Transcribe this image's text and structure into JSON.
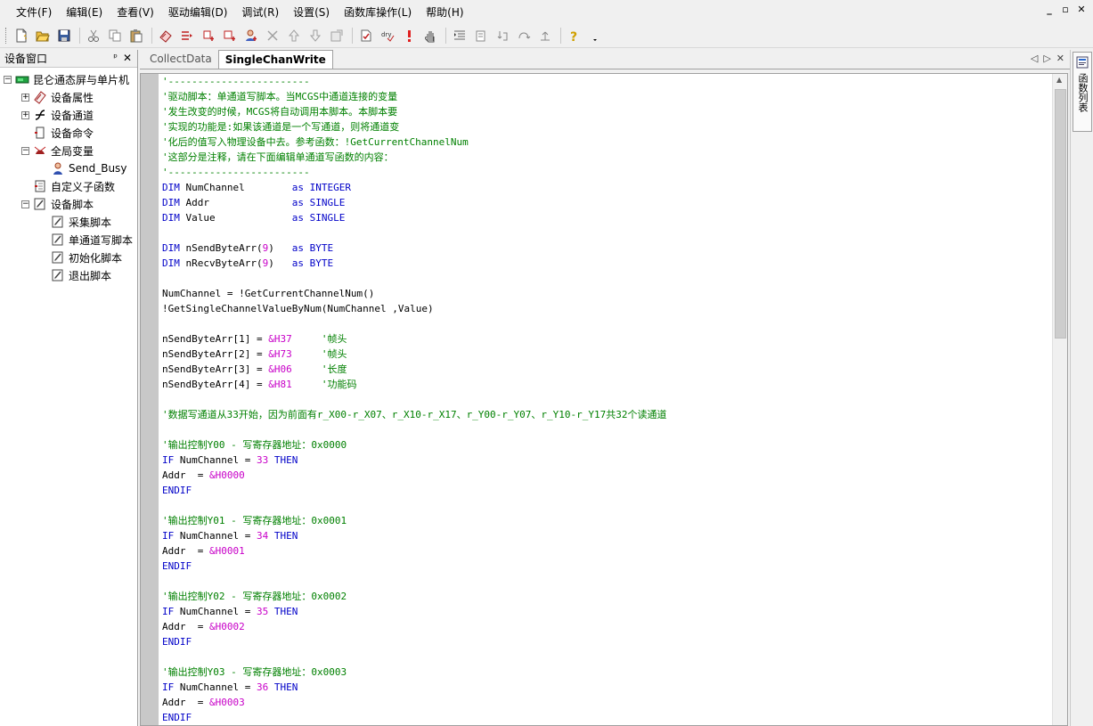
{
  "menu": [
    "文件(F)",
    "编辑(E)",
    "查看(V)",
    "驱动编辑(D)",
    "调试(R)",
    "设置(S)",
    "函数库操作(L)",
    "帮助(H)"
  ],
  "window_controls": [
    "_",
    "▫",
    "✕"
  ],
  "panel": {
    "title": "设备窗口",
    "pin": "ᵖ",
    "close": "✕",
    "tree": [
      {
        "label": "昆仑通态屏与单片机",
        "icon": "device-icon",
        "level": 0,
        "expander": "−"
      },
      {
        "label": "设备属性",
        "icon": "property-icon",
        "level": 1,
        "expander": "+"
      },
      {
        "label": "设备通道",
        "icon": "channel-icon",
        "level": 1,
        "expander": "+"
      },
      {
        "label": "设备命令",
        "icon": "command-icon",
        "level": 1,
        "expander": ""
      },
      {
        "label": "全局变量",
        "icon": "variables-icon",
        "level": 1,
        "expander": "−"
      },
      {
        "label": "Send_Busy",
        "icon": "user-icon",
        "level": 2,
        "expander": ""
      },
      {
        "label": "自定义子函数",
        "icon": "function-icon",
        "level": 1,
        "expander": ""
      },
      {
        "label": "设备脚本",
        "icon": "script-icon",
        "level": 1,
        "expander": "−"
      },
      {
        "label": "采集脚本",
        "icon": "script-icon",
        "level": 2,
        "expander": ""
      },
      {
        "label": "单通道写脚本",
        "icon": "script-icon",
        "level": 2,
        "expander": ""
      },
      {
        "label": "初始化脚本",
        "icon": "script-icon",
        "level": 2,
        "expander": ""
      },
      {
        "label": "退出脚本",
        "icon": "script-icon",
        "level": 2,
        "expander": ""
      }
    ]
  },
  "tabs": [
    {
      "label": "CollectData",
      "active": false
    },
    {
      "label": "SingleChanWrite",
      "active": true
    }
  ],
  "tab_controls": [
    "◁",
    "▷",
    "✕"
  ],
  "right_tab": {
    "label": "函数列表"
  },
  "code_lines": [
    [
      {
        "t": "'------------------------",
        "c": "com"
      }
    ],
    [
      {
        "t": "'驱动脚本：单通道写脚本。当MCGS中通道连接的变量",
        "c": "com"
      }
    ],
    [
      {
        "t": "'发生改变的时候，MCGS将自动调用本脚本。本脚本要",
        "c": "com"
      }
    ],
    [
      {
        "t": "'实现的功能是:如果该通道是一个写通道，则将通道变",
        "c": "com"
      }
    ],
    [
      {
        "t": "'化后的值写入物理设备中去。参考函数：!GetCurrentChannelNum",
        "c": "com"
      }
    ],
    [
      {
        "t": "'这部分是注释，请在下面编辑单通道写函数的内容：",
        "c": "com"
      }
    ],
    [
      {
        "t": "'------------------------",
        "c": "com"
      }
    ],
    [
      {
        "t": "DIM",
        "c": "kw"
      },
      {
        "t": " NumChannel        ",
        "c": "txt"
      },
      {
        "t": "as",
        "c": "kw"
      },
      {
        "t": " ",
        "c": "txt"
      },
      {
        "t": "INTEGER",
        "c": "kw"
      }
    ],
    [
      {
        "t": "DIM",
        "c": "kw"
      },
      {
        "t": " Addr              ",
        "c": "txt"
      },
      {
        "t": "as",
        "c": "kw"
      },
      {
        "t": " ",
        "c": "txt"
      },
      {
        "t": "SINGLE",
        "c": "kw"
      }
    ],
    [
      {
        "t": "DIM",
        "c": "kw"
      },
      {
        "t": " Value             ",
        "c": "txt"
      },
      {
        "t": "as",
        "c": "kw"
      },
      {
        "t": " ",
        "c": "txt"
      },
      {
        "t": "SINGLE",
        "c": "kw"
      }
    ],
    [],
    [
      {
        "t": "DIM",
        "c": "kw"
      },
      {
        "t": " nSendByteArr(",
        "c": "txt"
      },
      {
        "t": "9",
        "c": "num"
      },
      {
        "t": ")   ",
        "c": "txt"
      },
      {
        "t": "as",
        "c": "kw"
      },
      {
        "t": " ",
        "c": "txt"
      },
      {
        "t": "BYTE",
        "c": "kw"
      }
    ],
    [
      {
        "t": "DIM",
        "c": "kw"
      },
      {
        "t": " nRecvByteArr(",
        "c": "txt"
      },
      {
        "t": "9",
        "c": "num"
      },
      {
        "t": ")   ",
        "c": "txt"
      },
      {
        "t": "as",
        "c": "kw"
      },
      {
        "t": " ",
        "c": "txt"
      },
      {
        "t": "BYTE",
        "c": "kw"
      }
    ],
    [],
    [
      {
        "t": "NumChannel = !GetCurrentChannelNum()",
        "c": "txt"
      }
    ],
    [
      {
        "t": "!GetSingleChannelValueByNum(NumChannel ,Value)",
        "c": "txt"
      }
    ],
    [],
    [
      {
        "t": "nSendByteArr[1] = ",
        "c": "txt"
      },
      {
        "t": "&H37",
        "c": "hex"
      },
      {
        "t": "     ",
        "c": "txt"
      },
      {
        "t": "'帧头",
        "c": "com"
      }
    ],
    [
      {
        "t": "nSendByteArr[2] = ",
        "c": "txt"
      },
      {
        "t": "&H73",
        "c": "hex"
      },
      {
        "t": "     ",
        "c": "txt"
      },
      {
        "t": "'帧头",
        "c": "com"
      }
    ],
    [
      {
        "t": "nSendByteArr[3] = ",
        "c": "txt"
      },
      {
        "t": "&H06",
        "c": "hex"
      },
      {
        "t": "     ",
        "c": "txt"
      },
      {
        "t": "'长度",
        "c": "com"
      }
    ],
    [
      {
        "t": "nSendByteArr[4] = ",
        "c": "txt"
      },
      {
        "t": "&H81",
        "c": "hex"
      },
      {
        "t": "     ",
        "c": "txt"
      },
      {
        "t": "'功能码",
        "c": "com"
      }
    ],
    [],
    [
      {
        "t": "'数据写通道从33开始，因为前面有r_X00-r_X07、r_X10-r_X17、r_Y00-r_Y07、r_Y10-r_Y17共32个读通道",
        "c": "com"
      }
    ],
    [],
    [
      {
        "t": "'输出控制Y00 - 写寄存器地址：0x0000",
        "c": "com"
      }
    ],
    [
      {
        "t": "IF",
        "c": "kw"
      },
      {
        "t": " NumChannel = ",
        "c": "txt"
      },
      {
        "t": "33",
        "c": "num"
      },
      {
        "t": " ",
        "c": "txt"
      },
      {
        "t": "THEN",
        "c": "kw"
      }
    ],
    [
      {
        "t": "Addr  = ",
        "c": "txt"
      },
      {
        "t": "&H0000",
        "c": "hex"
      }
    ],
    [
      {
        "t": "ENDIF",
        "c": "kw"
      }
    ],
    [],
    [
      {
        "t": "'输出控制Y01 - 写寄存器地址：0x0001",
        "c": "com"
      }
    ],
    [
      {
        "t": "IF",
        "c": "kw"
      },
      {
        "t": " NumChannel = ",
        "c": "txt"
      },
      {
        "t": "34",
        "c": "num"
      },
      {
        "t": " ",
        "c": "txt"
      },
      {
        "t": "THEN",
        "c": "kw"
      }
    ],
    [
      {
        "t": "Addr  = ",
        "c": "txt"
      },
      {
        "t": "&H0001",
        "c": "hex"
      }
    ],
    [
      {
        "t": "ENDIF",
        "c": "kw"
      }
    ],
    [],
    [
      {
        "t": "'输出控制Y02 - 写寄存器地址：0x0002",
        "c": "com"
      }
    ],
    [
      {
        "t": "IF",
        "c": "kw"
      },
      {
        "t": " NumChannel = ",
        "c": "txt"
      },
      {
        "t": "35",
        "c": "num"
      },
      {
        "t": " ",
        "c": "txt"
      },
      {
        "t": "THEN",
        "c": "kw"
      }
    ],
    [
      {
        "t": "Addr  = ",
        "c": "txt"
      },
      {
        "t": "&H0002",
        "c": "hex"
      }
    ],
    [
      {
        "t": "ENDIF",
        "c": "kw"
      }
    ],
    [],
    [
      {
        "t": "'输出控制Y03 - 写寄存器地址：0x0003",
        "c": "com"
      }
    ],
    [
      {
        "t": "IF",
        "c": "kw"
      },
      {
        "t": " NumChannel = ",
        "c": "txt"
      },
      {
        "t": "36",
        "c": "num"
      },
      {
        "t": " ",
        "c": "txt"
      },
      {
        "t": "THEN",
        "c": "kw"
      }
    ],
    [
      {
        "t": "Addr  = ",
        "c": "txt"
      },
      {
        "t": "&H0003",
        "c": "hex"
      }
    ],
    [
      {
        "t": "ENDIF",
        "c": "kw"
      }
    ]
  ],
  "toolbar_icons": [
    "new-file-icon",
    "open-folder-icon",
    "save-icon",
    "|",
    "cut-icon",
    "copy-icon",
    "paste-icon",
    "|",
    "add-device-icon",
    "add-channel-icon",
    "add-command-icon",
    "add-variable-icon",
    "add-user-icon",
    "delete-icon",
    "move-up-icon",
    "move-down-icon",
    "properties-icon",
    "|",
    "compile-icon",
    "debug-icon",
    "stop-icon",
    "hand-icon",
    "|",
    "indent-icon",
    "outdent-icon",
    "step-into-icon",
    "step-over-icon",
    "step-out-icon",
    "|",
    "help-icon",
    "dropdown-icon"
  ]
}
